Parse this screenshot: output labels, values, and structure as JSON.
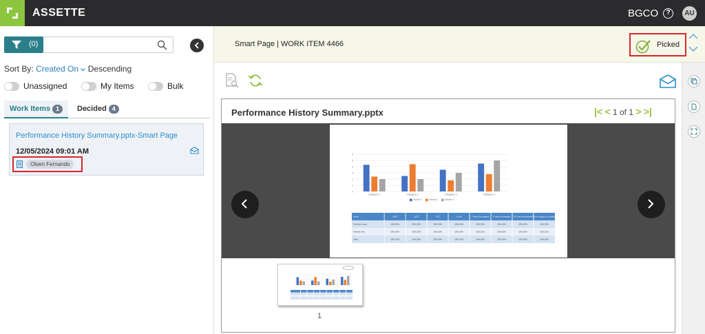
{
  "app": {
    "title": "ASSETTE",
    "org": "BGCO",
    "help": "?",
    "avatar": "AU"
  },
  "left": {
    "filter_count": "(0)",
    "search_placeholder": "",
    "sort_prefix": "Sort By:",
    "sort_field": "Created On",
    "sort_order": "Descending",
    "toggles": [
      "Unassigned",
      "My Items",
      "Bulk"
    ],
    "tabs": [
      {
        "label": "Work Items",
        "count": "1"
      },
      {
        "label": "Decided",
        "count": "4"
      }
    ],
    "card": {
      "title": "Performance History Summary.pptx-Smart Page",
      "date": "12/05/2024 09:01 AM",
      "assignee": "Olsen Fernando"
    }
  },
  "header": {
    "page": "Smart Page",
    "sep": "|",
    "work_item_label": "WORK ITEM",
    "work_item_number": "4466",
    "status": "Picked"
  },
  "viewer": {
    "title": "Performance History Summary.pptx",
    "page_current": "1",
    "page_of": "of",
    "page_total": "1",
    "thumb_number": "1"
  },
  "colors": {
    "brand": "#8cc63f",
    "teal": "#2a7f8a",
    "highlight": "#d9252a",
    "link": "#2a8fc8"
  },
  "chart_data": {
    "type": "bar",
    "categories": [
      "Category 1",
      "Category 2",
      "Category 3",
      "Category 4"
    ],
    "series": [
      {
        "name": "Series 1",
        "values": [
          4.3,
          2.5,
          3.5,
          4.5
        ]
      },
      {
        "name": "Series 2",
        "values": [
          2.4,
          4.4,
          1.8,
          2.8
        ]
      },
      {
        "name": "Series 3",
        "values": [
          2,
          2,
          3,
          5
        ]
      }
    ],
    "ylim": [
      0,
      6
    ],
    "yticks": [
      "0",
      "1",
      "2",
      "3",
      "4",
      "5",
      "6"
    ],
    "colors": [
      "#4472c4",
      "#ed7d31",
      "#a5a5a5"
    ],
    "legend": "bottom"
  },
  "table": {
    "headers": [
      "Name",
      "MTD",
      "QTD",
      "YTD",
      "1 Year",
      "3 Years Annualized",
      "5 Years Annualized",
      "10 Years Annualized",
      "Since Inception Annualized"
    ],
    "rows": [
      [
        "Portfolio Gross",
        "10%.20%",
        "10%.20%",
        "10%.20%",
        "10%.20%",
        "10%.20%",
        "10%.20%",
        "10%.20%",
        "10%.20%"
      ],
      [
        "Portfolio Net",
        "10%.20%",
        "10%.20%",
        "10%.20%",
        "10%.20%",
        "10%.20%",
        "10%.20%",
        "10%.20%",
        "10%.20%"
      ],
      [
        "Index",
        "10%.20%",
        "10%.20%",
        "10%.20%",
        "10%.20%",
        "10%.20%",
        "10%.20%",
        "10%.20%",
        "10%.20%"
      ]
    ]
  }
}
